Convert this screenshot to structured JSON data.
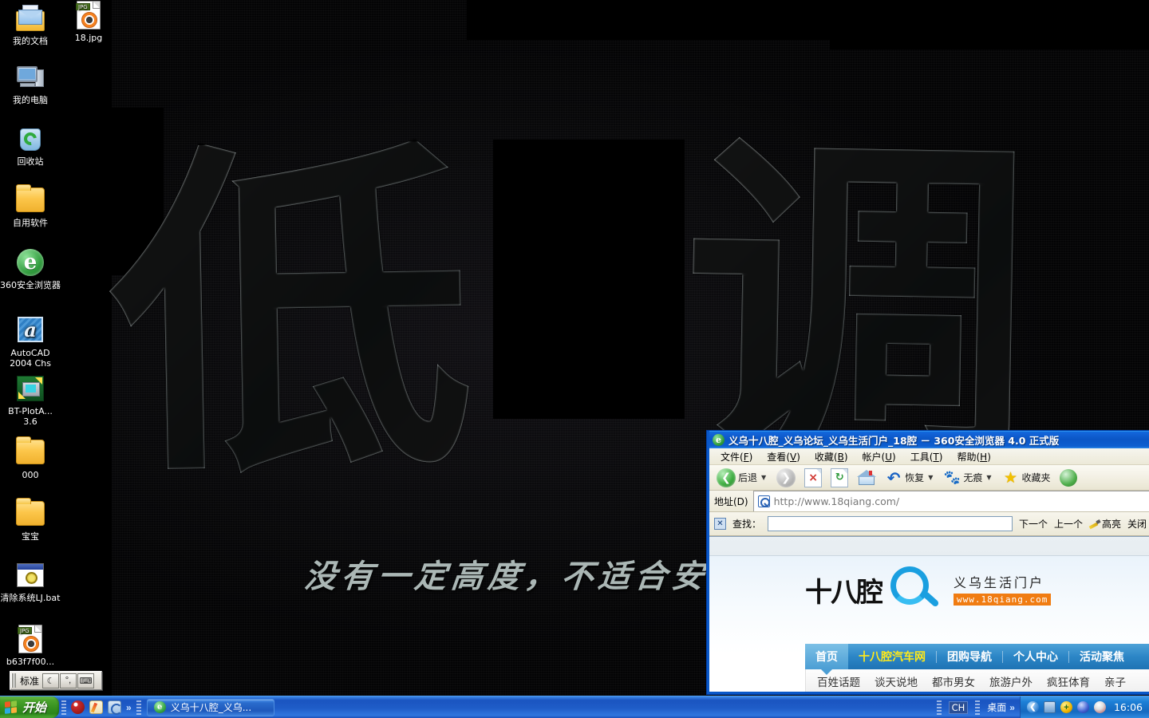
{
  "desktop": {
    "wallpaper": {
      "glyph_left": "低",
      "glyph_right": "调",
      "slogan": "没有一定高度，不适合安"
    },
    "icons": [
      {
        "label": "我的文档",
        "icon": "my-documents-icon"
      },
      {
        "label": "18.jpg",
        "icon": "jpg-file-icon"
      },
      {
        "label": "我的电脑",
        "icon": "my-computer-icon"
      },
      {
        "label": "回收站",
        "icon": "recycle-bin-icon"
      },
      {
        "label": "自用软件",
        "icon": "folder-icon"
      },
      {
        "label": "360安全浏览器",
        "icon": "360-browser-icon"
      },
      {
        "label": "AutoCAD 2004 Chs",
        "icon": "autocad-icon"
      },
      {
        "label": "BT-PlotA... 3.6",
        "icon": "bt-plot-icon"
      },
      {
        "label": "000",
        "icon": "folder-icon"
      },
      {
        "label": "宝宝",
        "icon": "folder-icon"
      },
      {
        "label": "清除系统LJ.bat",
        "icon": "batch-file-icon"
      },
      {
        "label": "b63f7f00...",
        "icon": "jpg-file-icon"
      }
    ]
  },
  "ime_bar": {
    "label": "标准",
    "buttons": [
      "moon-icon",
      "punctuation-icon",
      "keyboard-icon"
    ]
  },
  "browser": {
    "title": "义乌十八腔_义乌论坛_义乌生活门户_18腔 － 360安全浏览器 4.0 正式版",
    "title_icon": "360-browser-icon",
    "menus": [
      {
        "text": "文件",
        "key": "F"
      },
      {
        "text": "查看",
        "key": "V"
      },
      {
        "text": "收藏",
        "key": "B"
      },
      {
        "text": "帐户",
        "key": "U"
      },
      {
        "text": "工具",
        "key": "T"
      },
      {
        "text": "帮助",
        "key": "H"
      }
    ],
    "toolbar": {
      "back_label": "后退",
      "forward_label": "",
      "stop_label": "",
      "refresh_label": "",
      "home_label": "",
      "restore_label": "恢复",
      "trace_label": "无痕",
      "favorites_label": "收藏夹",
      "icons": [
        "back-arrow-icon",
        "forward-arrow-icon",
        "stop-icon",
        "refresh-icon",
        "home-icon",
        "restore-icon",
        "paw-icon",
        "star-icon",
        "speed-icon"
      ]
    },
    "address": {
      "label": "地址(D)",
      "key": "D",
      "url": "http://www.18qiang.com/",
      "icon": "search-globe-icon"
    },
    "findbar": {
      "close_icon": "close-icon",
      "label": "查找：",
      "value": "",
      "next": "下一个",
      "prev": "上一个",
      "highlight": "高亮",
      "close": "关闭"
    }
  },
  "webpage": {
    "logo": {
      "wordmark": "十八腔",
      "tagline": "义乌生活门户",
      "url": "www.18qiang.com"
    },
    "main_nav": [
      {
        "label": "首页",
        "state": "active"
      },
      {
        "label": "十八腔汽车网",
        "state": "highlight"
      },
      {
        "label": "团购导航",
        "state": "normal"
      },
      {
        "label": "个人中心",
        "state": "normal"
      },
      {
        "label": "活动聚焦",
        "state": "normal"
      }
    ],
    "sub_nav": [
      "百姓话题",
      "谈天说地",
      "都市男女",
      "旅游户外",
      "疯狂体育",
      "亲子"
    ]
  },
  "taskbar": {
    "start_label": "开始",
    "quick_launch": [
      "media-player-icon",
      "notepad-icon",
      "browser-icon"
    ],
    "quick_launch_more": "»",
    "tasks": [
      {
        "label": "义乌十八腔_义乌...",
        "icon": "360-browser-icon"
      }
    ],
    "language_indicator": "CH",
    "desktop_toolbar_label": "桌面",
    "toolbar_more": "»",
    "tray_icons": [
      "show-hidden-icon",
      "network-icon",
      "shield-icon",
      "moon-icon",
      "qq-penguin-icon"
    ],
    "clock": "16:06"
  },
  "colors": {
    "taskbar_blue": "#1f5dc8",
    "titlebar_blue": "#0b56c6",
    "start_green": "#35901f",
    "nav_blue": "#2c86c6",
    "accent_yellow": "#ffe91a",
    "logo_orange": "#f07c12"
  }
}
